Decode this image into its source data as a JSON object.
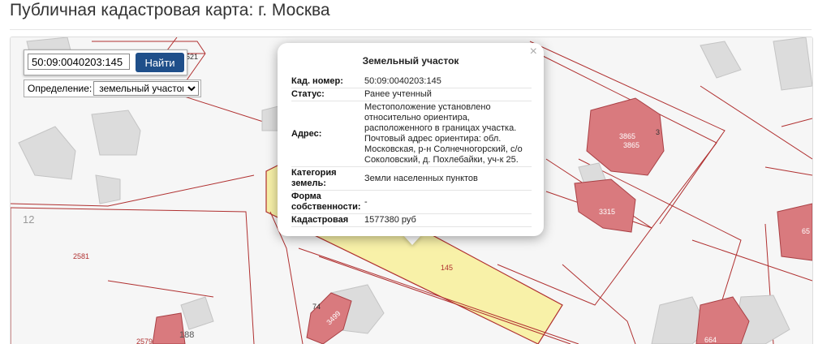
{
  "header": {
    "title": "Публичная кадастровая карта: г. Москва"
  },
  "search": {
    "value": "50:09:0040203:145",
    "button_label": "Найти"
  },
  "definition": {
    "label": "Определение:",
    "selected": "земельный участок"
  },
  "popup": {
    "title": "Земельный участок",
    "close_symbol": "×",
    "rows": [
      {
        "label": "Кад. номер:",
        "value": "50:09:0040203:145"
      },
      {
        "label": "Статус:",
        "value": "Ранее учтенный"
      },
      {
        "label": "Адрес:",
        "value": "Местоположение установлено относительно ориентира, расположенного в границах участка. Почтовый адрес ориентира: обл. Московская, р-н Солнечногорский, с/о Соколовский, д. Похлебайки, уч-к 25."
      },
      {
        "label": "Категория земель:",
        "value": "Земли населенных пунктов"
      },
      {
        "label": "Форма собственности:",
        "value": "-"
      },
      {
        "label": "Кадастровая",
        "value": "1577380 руб"
      }
    ]
  },
  "map": {
    "labels": {
      "l521": "521",
      "l12": "12",
      "l2581": "2581",
      "l145": "145",
      "l74": "74",
      "l3499": "3499",
      "l188": "188",
      "l2579": "2579",
      "l3865a": "3865",
      "l3865b": "3865",
      "l3315": "3315",
      "l664": "664",
      "l65": "65",
      "l3": "3"
    },
    "colors": {
      "parcel_line": "#b03030",
      "building": "#d97a7e",
      "selected": "#f8f1a8",
      "gray_building": "#dcdcdc"
    }
  }
}
